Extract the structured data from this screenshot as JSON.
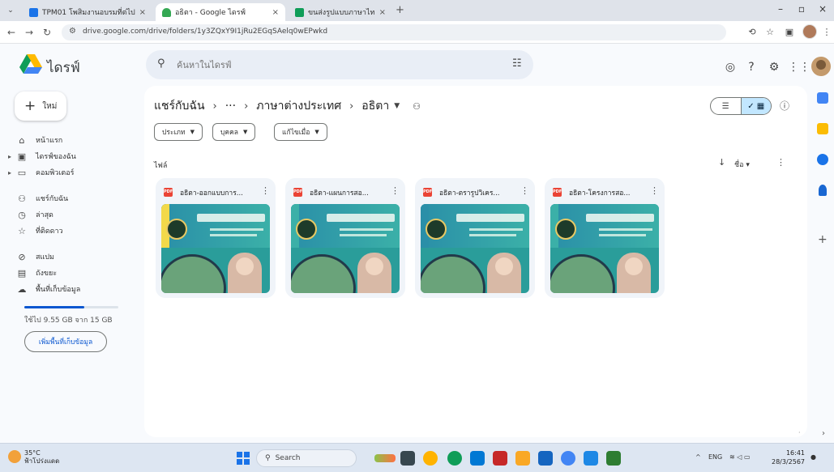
{
  "browser": {
    "tabs": [
      {
        "title": "TPM01 โพสิมงานอบรมที่ต่ไป",
        "active": false,
        "color": "#1a73e8"
      },
      {
        "title": "อธิตา - Google ไดรฟ์",
        "active": true,
        "color": "#34a853"
      },
      {
        "title": "ขนส่งรูปแบบภาษาไทย - Google ชีต",
        "active": false,
        "color": "#0f9d58"
      }
    ],
    "url": "drive.google.com/drive/folders/1y3ZQxY9I1jRu2EGqSAelq0wEPwkd"
  },
  "drive": {
    "brand": "ไดรฟ์",
    "search_placeholder": "ค้นหาในไดรฟ์",
    "new_label": "ใหม่",
    "nav": [
      {
        "label": "หน้าแรก",
        "icon": "home-icon",
        "glyph": "⌂",
        "caret": false
      },
      {
        "label": "ไดรฟ์ของฉัน",
        "icon": "my-drive-icon",
        "glyph": "▣",
        "caret": true
      },
      {
        "label": "คอมพิวเตอร์",
        "icon": "computer-icon",
        "glyph": "▭",
        "caret": true
      },
      {
        "label": "แชร์กับฉัน",
        "icon": "shared-icon",
        "glyph": "⚇",
        "caret": false
      },
      {
        "label": "ล่าสุด",
        "icon": "clock-icon",
        "glyph": "◷",
        "caret": false
      },
      {
        "label": "ที่ติดดาว",
        "icon": "star-icon",
        "glyph": "☆",
        "caret": false
      },
      {
        "label": "สแปม",
        "icon": "spam-icon",
        "glyph": "⊘",
        "caret": false
      },
      {
        "label": "ถังขยะ",
        "icon": "trash-icon",
        "glyph": "▤",
        "caret": false
      },
      {
        "label": "พื้นที่เก็บข้อมูล",
        "icon": "cloud-icon",
        "glyph": "☁",
        "caret": false
      }
    ],
    "storage_text": "ใช้ไป 9.55 GB จาก 15 GB",
    "storage_used_fraction": 0.64,
    "get_more_label": "เพิ่มพื้นที่เก็บข้อมูล",
    "breadcrumb": {
      "root": "แชร์กับฉัน",
      "ellipsis": "···",
      "parent": "ภาษาต่างประเทศ",
      "current": "อธิตา"
    },
    "filters": [
      "ประเภท",
      "บุคคล",
      "แก้ไขเมื่อ"
    ],
    "section_label": "ไฟล์",
    "sort_label": "ชื่อ",
    "files": [
      {
        "name": "อธิตา-ออกแบบการ..."
      },
      {
        "name": "อธิตา-แผนการสอ..."
      },
      {
        "name": "อธิตา-ตรารูปวิเคร..."
      },
      {
        "name": "อธิตา-โครงการสอ..."
      }
    ]
  },
  "taskbar": {
    "weather_temp": "35°C",
    "weather_desc": "ฟ้าโปร่งแดด",
    "search_label": "Search",
    "lang": "ENG",
    "time": "16:41",
    "date": "28/3/2567"
  },
  "colors": {
    "accent": "#0b57d0",
    "pdf": "#ea4335",
    "selected_toggle": "#c2e7ff"
  }
}
